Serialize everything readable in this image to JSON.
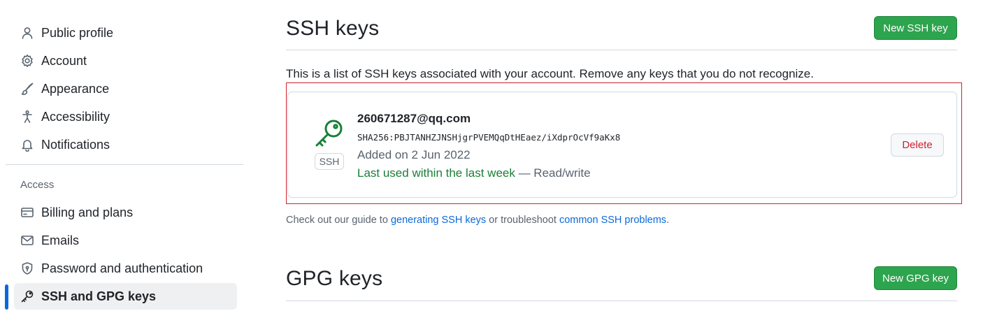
{
  "sidebar": {
    "items": [
      {
        "label": "Public profile",
        "icon": "person-icon"
      },
      {
        "label": "Account",
        "icon": "gear-icon"
      },
      {
        "label": "Appearance",
        "icon": "paintbrush-icon"
      },
      {
        "label": "Accessibility",
        "icon": "accessibility-icon"
      },
      {
        "label": "Notifications",
        "icon": "bell-icon"
      }
    ],
    "access_label": "Access",
    "access_items": [
      {
        "label": "Billing and plans",
        "icon": "credit-card-icon"
      },
      {
        "label": "Emails",
        "icon": "mail-icon"
      },
      {
        "label": "Password and authentication",
        "icon": "shield-lock-icon"
      },
      {
        "label": "SSH and GPG keys",
        "icon": "key-icon",
        "active": true
      }
    ]
  },
  "ssh": {
    "title": "SSH keys",
    "new_button": "New SSH key",
    "intro": "This is a list of SSH keys associated with your account. Remove any keys that you do not recognize.",
    "key": {
      "title": "260671287@qq.com",
      "fingerprint": "SHA256:PBJTANHZJNSHjgrPVEMQqDtHEaez/iXdprOcVf9aKx8",
      "badge": "SSH",
      "added": "Added on 2 Jun 2022",
      "last_used": "Last used within the last week",
      "access": " — Read/write",
      "delete_label": "Delete"
    },
    "guide": {
      "prefix": "Check out our guide to ",
      "link1": "generating SSH keys",
      "middle": " or troubleshoot ",
      "link2": "common SSH problems",
      "suffix": "."
    }
  },
  "gpg": {
    "title": "GPG keys",
    "new_button": "New GPG key"
  },
  "colors": {
    "accent": "#0969da",
    "primary_button": "#2da44e",
    "danger": "#cf222e",
    "success_text": "#1a7f37",
    "highlight_border": "#cf222e"
  }
}
